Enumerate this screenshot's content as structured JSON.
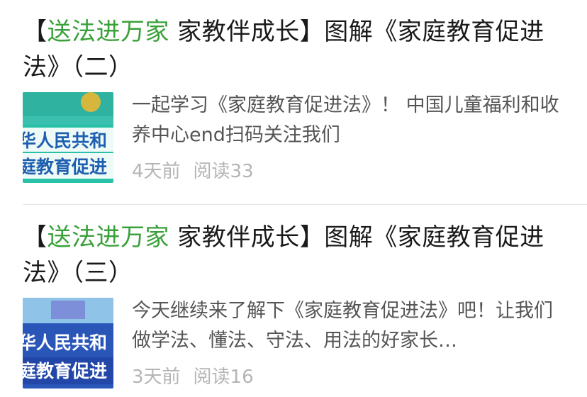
{
  "articles": [
    {
      "title_highlight": "送法进万家",
      "title_rest": " 家教伴成长】图解《家庭教育促进法》（二）",
      "title_open": "【",
      "summary": "一起学习《家庭教育促进法》！ 中国儿童福利和收养中心end扫码关注我们",
      "time": "4天前",
      "reads": "阅读33",
      "thumb_line1": "华人民共和",
      "thumb_line2": "庭教育促进",
      "thumb_colors": {
        "top": "#3bbfae",
        "band": "#ffffff",
        "bottom": "#28c1a7",
        "text": "#1f5fb0",
        "accent": "#f3b62a"
      }
    },
    {
      "title_highlight": "送法进万家",
      "title_rest": " 家教伴成长】图解《家庭教育促进法》（三）",
      "title_open": "【",
      "summary": "今天继续来了解下《家庭教育促进法》吧！让我们做学法、懂法、守法、用法的好家长…",
      "time": "3天前",
      "reads": "阅读16",
      "thumb_line1": "华人民共和",
      "thumb_line2": "庭教育促进",
      "thumb_colors": {
        "top": "#8fc4e8",
        "band": "#ffffff",
        "bottom": "#2a56b8",
        "text": "#ffffff",
        "accent": "#7d8fd8"
      }
    }
  ],
  "colors": {
    "highlight": "#3aa13a",
    "summary": "#555555",
    "meta": "#b5b5b5",
    "divider": "#e5e5e5"
  }
}
